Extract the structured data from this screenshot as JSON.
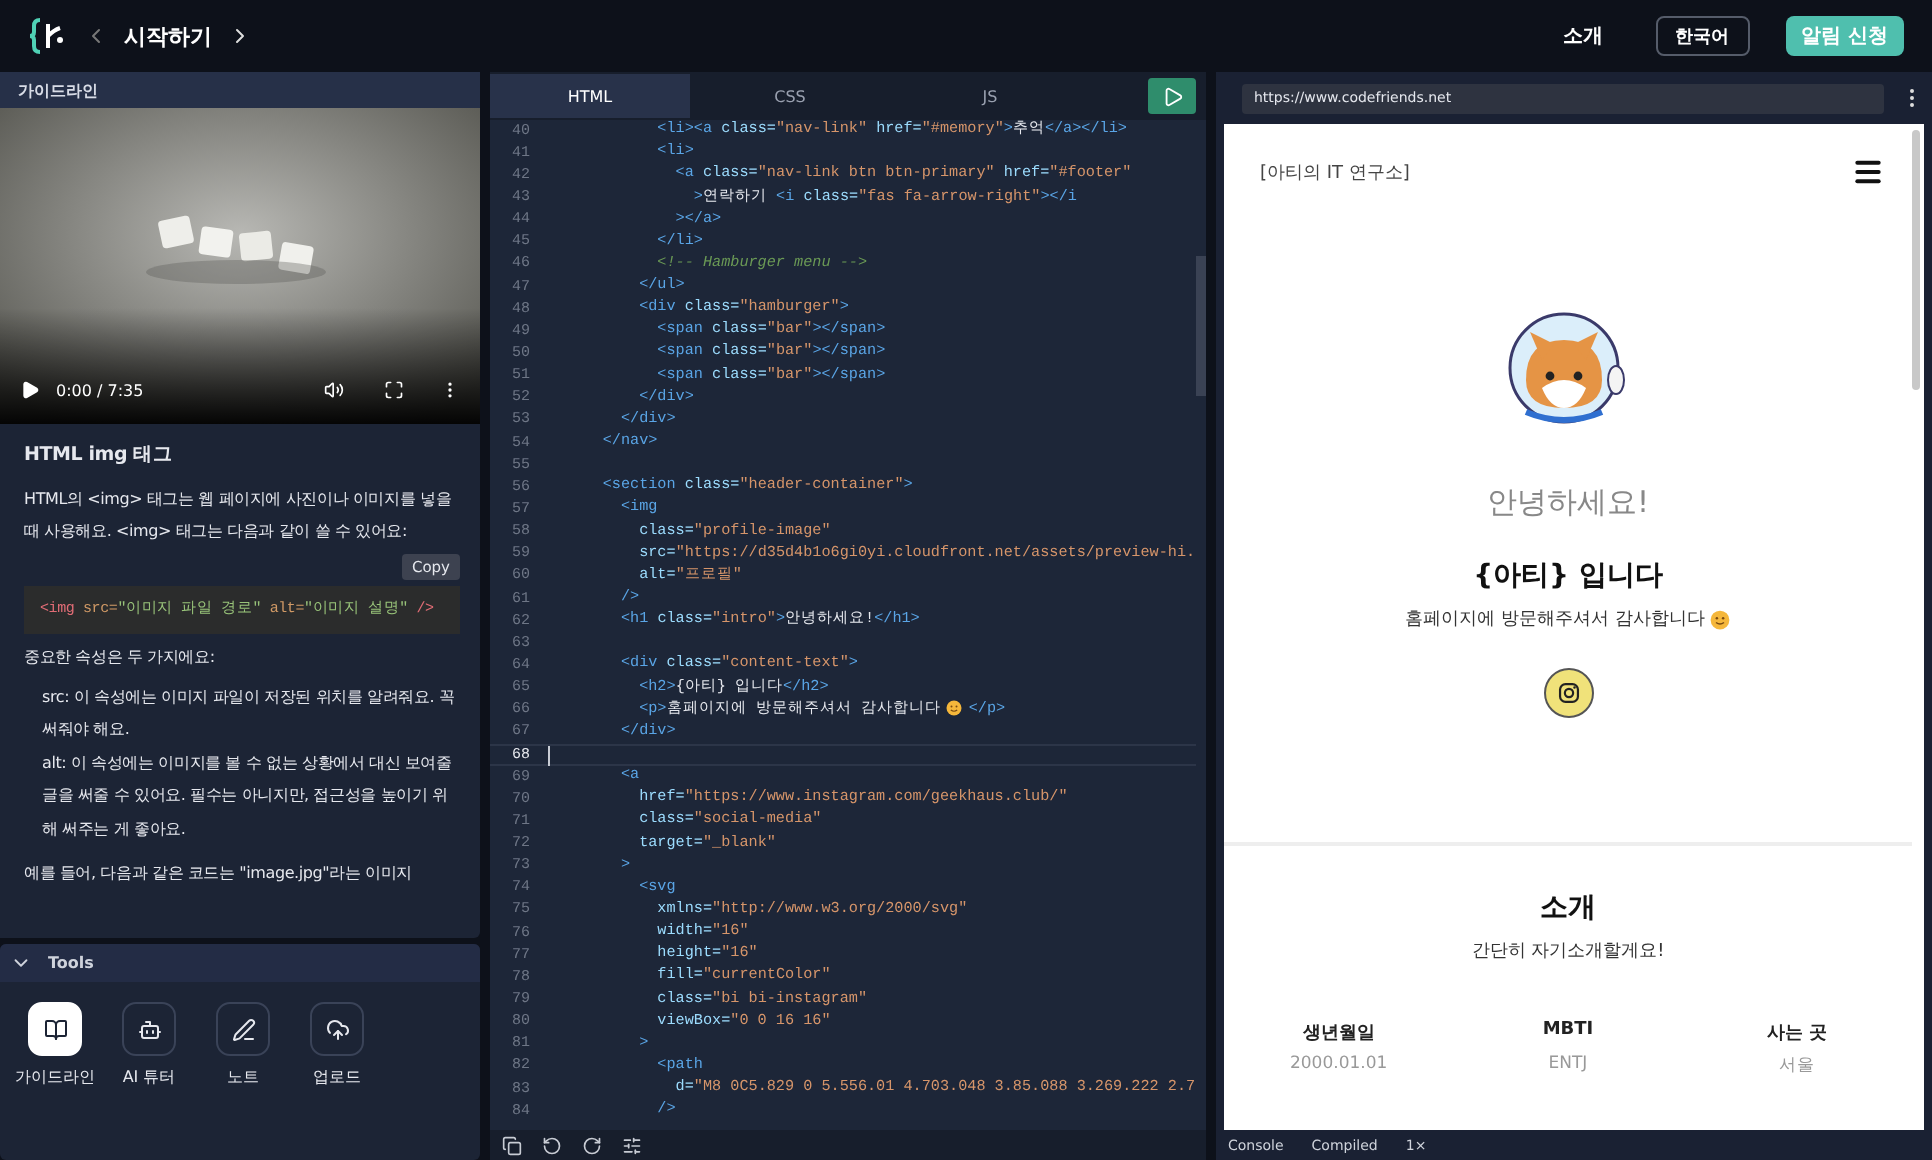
{
  "topbar": {
    "title": "시작하기",
    "links": [
      {
        "label": "소개"
      }
    ],
    "language": "한국어",
    "cta": "알림 신청"
  },
  "guide": {
    "header": "가이드라인",
    "video": {
      "kind": "picture",
      "time": "0:00 / 7:35"
    },
    "title": "HTML img 태그",
    "intro": "HTML의 <img> 태그는 웹 페이지에 사진이나 이미지를 넣을 때 사용해요. <img> 태그는 다음과 같이 쓸 수 있어요:",
    "copy": "Copy",
    "example": [
      {
        "kind": "tag",
        "t": "<img"
      },
      {
        "kind": "attr",
        "t": " src="
      },
      {
        "kind": "string",
        "t": "\"이미지 파일 경로\""
      },
      {
        "kind": "attr",
        "t": " alt="
      },
      {
        "kind": "string",
        "t": "\"이미지 설명\""
      },
      {
        "kind": "tag",
        "t": " />"
      }
    ],
    "attrs_intro": "중요한 속성은 두 가지에요:",
    "attrs": [
      "src: 이 속성에는 이미지 파일이 저장된 위치를 알려줘요. 꼭 써줘야 해요.",
      "alt: 이 속성에는 이미지를 볼 수 없는 상황에서 대신 보여줄 글을 써줄 수 있어요. 필수는 아니지만, 접근성을 높이기 위해 써주는 게 좋아요."
    ],
    "example_intro": "예를 들어, 다음과 같은 코드는 \"image.jpg\"라는 이미지"
  },
  "tools": {
    "label": "Tools",
    "expanded": true,
    "items": [
      {
        "label": "가이드라인",
        "kind": "book",
        "selected": true
      },
      {
        "label": "AI 튜터",
        "kind": "bot",
        "selected": false
      },
      {
        "label": "노트",
        "kind": "note",
        "selected": false
      },
      {
        "label": "업로드",
        "kind": "upload",
        "selected": false
      }
    ]
  },
  "editor": {
    "tabs": [
      {
        "label": "HTML",
        "selected": true
      },
      {
        "label": "CSS",
        "selected": false
      },
      {
        "label": "JS",
        "selected": false
      }
    ],
    "lines": [
      {
        "n": "40",
        "current": false,
        "tokens": [
          {
            "kind": "tag",
            "t": "            <li><a"
          },
          {
            "kind": "attr",
            "t": " class="
          },
          {
            "kind": "string",
            "t": "\"nav-link\""
          },
          {
            "kind": "attr",
            "t": " href="
          },
          {
            "kind": "string",
            "t": "\"#memory\""
          },
          {
            "kind": "tag",
            "t": ">"
          },
          {
            "kind": "text",
            "t": "추억"
          },
          {
            "kind": "tag",
            "t": "</a></li>"
          }
        ]
      },
      {
        "n": "41",
        "current": false,
        "tokens": [
          {
            "kind": "tag",
            "t": "            <li>"
          }
        ]
      },
      {
        "n": "42",
        "current": false,
        "tokens": [
          {
            "kind": "tag",
            "t": "              <a"
          },
          {
            "kind": "attr",
            "t": " class="
          },
          {
            "kind": "string",
            "t": "\"nav-link btn btn-primary\""
          },
          {
            "kind": "attr",
            "t": " href="
          },
          {
            "kind": "string",
            "t": "\"#footer\""
          }
        ]
      },
      {
        "n": "43",
        "current": false,
        "tokens": [
          {
            "kind": "tag",
            "t": "                >"
          },
          {
            "kind": "text",
            "t": "연락하기 "
          },
          {
            "kind": "tag",
            "t": "<i"
          },
          {
            "kind": "attr",
            "t": " class="
          },
          {
            "kind": "string",
            "t": "\"fas fa-arrow-right\""
          },
          {
            "kind": "tag",
            "t": "></i"
          }
        ]
      },
      {
        "n": "44",
        "current": false,
        "tokens": [
          {
            "kind": "tag",
            "t": "              ></a>"
          }
        ]
      },
      {
        "n": "45",
        "current": false,
        "tokens": [
          {
            "kind": "tag",
            "t": "            </li>"
          }
        ]
      },
      {
        "n": "46",
        "current": false,
        "tokens": [
          {
            "kind": "comment",
            "t": "            <!-- Hamburger menu -->"
          }
        ]
      },
      {
        "n": "47",
        "current": false,
        "tokens": [
          {
            "kind": "tag",
            "t": "          </ul>"
          }
        ]
      },
      {
        "n": "48",
        "current": false,
        "tokens": [
          {
            "kind": "tag",
            "t": "          <div"
          },
          {
            "kind": "attr",
            "t": " class="
          },
          {
            "kind": "string",
            "t": "\"hamburger\""
          },
          {
            "kind": "tag",
            "t": ">"
          }
        ]
      },
      {
        "n": "49",
        "current": false,
        "tokens": [
          {
            "kind": "tag",
            "t": "            <span"
          },
          {
            "kind": "attr",
            "t": " class="
          },
          {
            "kind": "string",
            "t": "\"bar\""
          },
          {
            "kind": "tag",
            "t": "></span>"
          }
        ]
      },
      {
        "n": "50",
        "current": false,
        "tokens": [
          {
            "kind": "tag",
            "t": "            <span"
          },
          {
            "kind": "attr",
            "t": " class="
          },
          {
            "kind": "string",
            "t": "\"bar\""
          },
          {
            "kind": "tag",
            "t": "></span>"
          }
        ]
      },
      {
        "n": "51",
        "current": false,
        "tokens": [
          {
            "kind": "tag",
            "t": "            <span"
          },
          {
            "kind": "attr",
            "t": " class="
          },
          {
            "kind": "string",
            "t": "\"bar\""
          },
          {
            "kind": "tag",
            "t": "></span>"
          }
        ]
      },
      {
        "n": "52",
        "current": false,
        "tokens": [
          {
            "kind": "tag",
            "t": "          </div>"
          }
        ]
      },
      {
        "n": "53",
        "current": false,
        "tokens": [
          {
            "kind": "tag",
            "t": "        </div>"
          }
        ]
      },
      {
        "n": "54",
        "current": false,
        "tokens": [
          {
            "kind": "tag",
            "t": "      </nav>"
          }
        ]
      },
      {
        "n": "55",
        "current": false
      },
      {
        "n": "56",
        "current": false,
        "tokens": [
          {
            "kind": "tag",
            "t": "      <section"
          },
          {
            "kind": "attr",
            "t": " class="
          },
          {
            "kind": "string",
            "t": "\"header-container\""
          },
          {
            "kind": "tag",
            "t": ">"
          }
        ]
      },
      {
        "n": "57",
        "current": false,
        "tokens": [
          {
            "kind": "tag",
            "t": "        <img"
          }
        ]
      },
      {
        "n": "58",
        "current": false,
        "tokens": [
          {
            "kind": "attr",
            "t": "          class="
          },
          {
            "kind": "string",
            "t": "\"profile-image\""
          }
        ]
      },
      {
        "n": "59",
        "current": false,
        "tokens": [
          {
            "kind": "attr",
            "t": "          src="
          },
          {
            "kind": "string",
            "t": "\"https://d35d4b1o6gi0yi.cloudfront.net/assets/preview-hi."
          }
        ]
      },
      {
        "n": "60",
        "current": false,
        "tokens": [
          {
            "kind": "attr",
            "t": "          alt="
          },
          {
            "kind": "string",
            "t": "\"프로필\""
          }
        ]
      },
      {
        "n": "61",
        "current": false,
        "tokens": [
          {
            "kind": "tag",
            "t": "        />"
          }
        ]
      },
      {
        "n": "62",
        "current": false,
        "tokens": [
          {
            "kind": "tag",
            "t": "        <h1"
          },
          {
            "kind": "attr",
            "t": " class="
          },
          {
            "kind": "string",
            "t": "\"intro\""
          },
          {
            "kind": "tag",
            "t": ">"
          },
          {
            "kind": "text",
            "t": "안녕하세요!"
          },
          {
            "kind": "tag",
            "t": "</h1>"
          }
        ]
      },
      {
        "n": "63",
        "current": false
      },
      {
        "n": "64",
        "current": false,
        "tokens": [
          {
            "kind": "tag",
            "t": "        <div"
          },
          {
            "kind": "attr",
            "t": " class="
          },
          {
            "kind": "string",
            "t": "\"content-text\""
          },
          {
            "kind": "tag",
            "t": ">"
          }
        ]
      },
      {
        "n": "65",
        "current": false,
        "tokens": [
          {
            "kind": "tag",
            "t": "          <h2>"
          },
          {
            "kind": "text",
            "t": "{아티} 입니다"
          },
          {
            "kind": "tag",
            "t": "</h2>"
          }
        ]
      },
      {
        "n": "66",
        "current": false,
        "tokens": [
          {
            "kind": "tag",
            "t": "          <p>"
          },
          {
            "kind": "text",
            "t": "홈페이지에 방문해주셔서 감사합니다"
          },
          {
            "kind": "smile"
          },
          {
            "kind": "tag",
            "t": "</p>"
          }
        ]
      },
      {
        "n": "67",
        "current": false,
        "tokens": [
          {
            "kind": "tag",
            "t": "        </div>"
          }
        ]
      },
      {
        "n": "68",
        "current": true
      },
      {
        "n": "69",
        "current": false,
        "tokens": [
          {
            "kind": "tag",
            "t": "        <a"
          }
        ]
      },
      {
        "n": "70",
        "current": false,
        "tokens": [
          {
            "kind": "attr",
            "t": "          href="
          },
          {
            "kind": "string",
            "t": "\"https://www.instagram.com/geekhaus.club/\""
          }
        ]
      },
      {
        "n": "71",
        "current": false,
        "tokens": [
          {
            "kind": "attr",
            "t": "          class="
          },
          {
            "kind": "string",
            "t": "\"social-media\""
          }
        ]
      },
      {
        "n": "72",
        "current": false,
        "tokens": [
          {
            "kind": "attr",
            "t": "          target="
          },
          {
            "kind": "string",
            "t": "\"_blank\""
          }
        ]
      },
      {
        "n": "73",
        "current": false,
        "tokens": [
          {
            "kind": "tag",
            "t": "        >"
          }
        ]
      },
      {
        "n": "74",
        "current": false,
        "tokens": [
          {
            "kind": "tag",
            "t": "          <svg"
          }
        ]
      },
      {
        "n": "75",
        "current": false,
        "tokens": [
          {
            "kind": "attr",
            "t": "            xmlns="
          },
          {
            "kind": "string",
            "t": "\"http://www.w3.org/2000/svg\""
          }
        ]
      },
      {
        "n": "76",
        "current": false,
        "tokens": [
          {
            "kind": "attr",
            "t": "            width="
          },
          {
            "kind": "string",
            "t": "\"16\""
          }
        ]
      },
      {
        "n": "77",
        "current": false,
        "tokens": [
          {
            "kind": "attr",
            "t": "            height="
          },
          {
            "kind": "string",
            "t": "\"16\""
          }
        ]
      },
      {
        "n": "78",
        "current": false,
        "tokens": [
          {
            "kind": "attr",
            "t": "            fill="
          },
          {
            "kind": "string",
            "t": "\"currentColor\""
          }
        ]
      },
      {
        "n": "79",
        "current": false,
        "tokens": [
          {
            "kind": "attr",
            "t": "            class="
          },
          {
            "kind": "string",
            "t": "\"bi bi-instagram\""
          }
        ]
      },
      {
        "n": "80",
        "current": false,
        "tokens": [
          {
            "kind": "attr",
            "t": "            viewBox="
          },
          {
            "kind": "string",
            "t": "\"0 0 16 16\""
          }
        ]
      },
      {
        "n": "81",
        "current": false,
        "tokens": [
          {
            "kind": "tag",
            "t": "          >"
          }
        ]
      },
      {
        "n": "82",
        "current": false,
        "tokens": [
          {
            "kind": "tag",
            "t": "            <path"
          }
        ]
      },
      {
        "n": "83",
        "current": false,
        "tokens": [
          {
            "kind": "attr",
            "t": "              d="
          },
          {
            "kind": "string",
            "t": "\"M8 0C5.829 0 5.556.01 4.703.048 3.85.088 3.269.222 2.7"
          }
        ]
      },
      {
        "n": "84",
        "current": false,
        "tokens": [
          {
            "kind": "tag",
            "t": "            />"
          }
        ]
      }
    ]
  },
  "preview": {
    "url": "https://www.codefriends.net",
    "site": {
      "brand": "[아티의 IT 연구소]",
      "greeting": "안녕하세요!",
      "name": "{아티} 입니다",
      "message": "홈페이지에 방문해주셔서 감사합니다",
      "about_title": "소개",
      "about_subtitle": "간단히 자기소개할게요!",
      "facts": [
        {
          "label": "생년월일",
          "value": "2000.01.01"
        },
        {
          "label": "MBTI",
          "value": "ENTJ"
        },
        {
          "label": "사는 곳",
          "value": "서울"
        }
      ]
    }
  },
  "status_bar": [
    "Console",
    "Compiled",
    "1×"
  ]
}
